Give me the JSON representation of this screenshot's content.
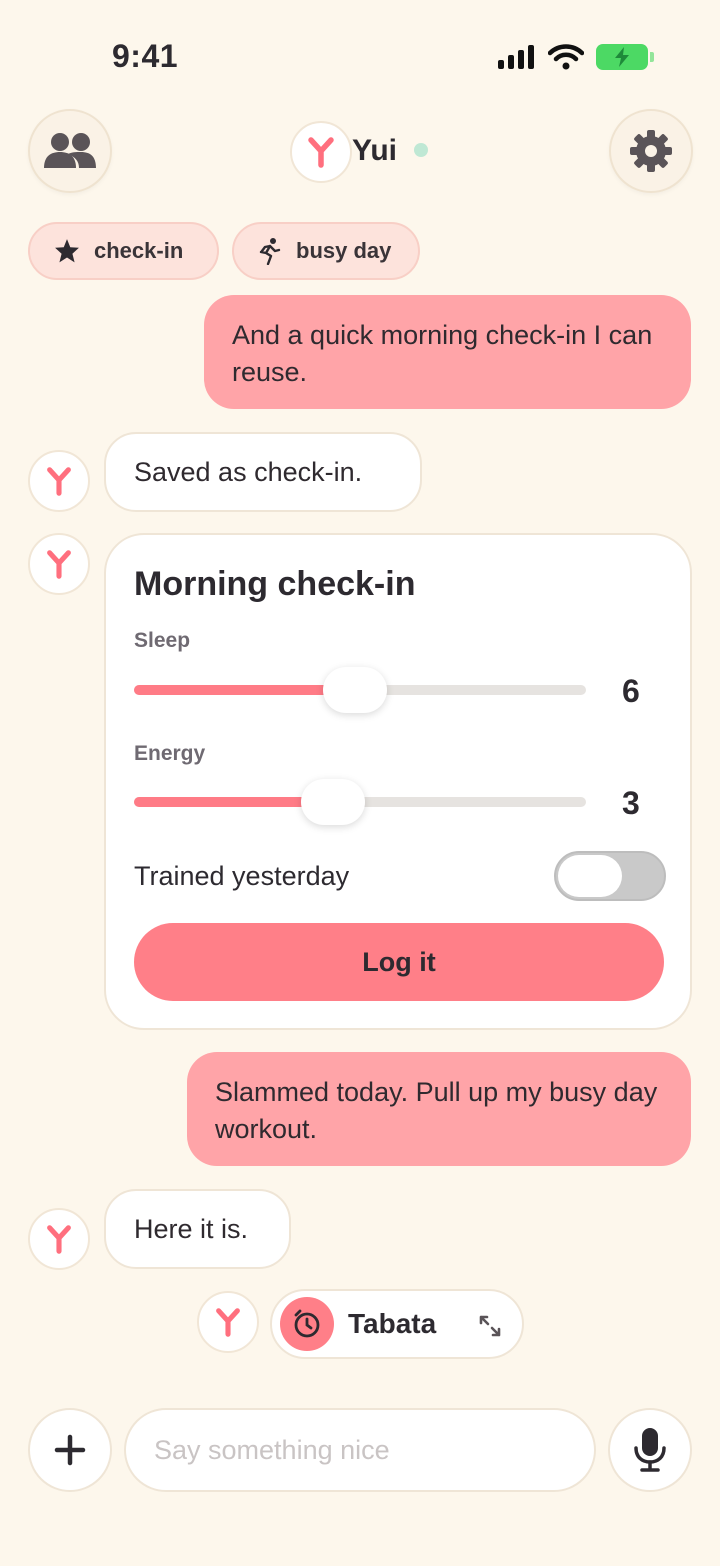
{
  "status_bar": {
    "time": "9:41"
  },
  "header": {
    "name": "Yui"
  },
  "chips": [
    {
      "label": "check-in",
      "icon": "star-icon"
    },
    {
      "label": "busy day",
      "icon": "running-icon"
    }
  ],
  "messages": {
    "user_1": "And a quick morning check-in I can reuse.",
    "bot_1": "Saved as check-in.",
    "user_2": "Slammed today. Pull up my busy day workout.",
    "bot_2": "Here it is."
  },
  "card": {
    "title": "Morning check-in",
    "sliders": [
      {
        "label": "Sleep",
        "value": "6",
        "fill": 0.49
      },
      {
        "label": "Energy",
        "value": "3",
        "fill": 0.44
      }
    ],
    "toggle": {
      "label": "Trained yesterday",
      "on": false
    },
    "button_label": "Log it"
  },
  "workout": {
    "label": "Tabata"
  },
  "composer": {
    "placeholder": "Say something nice"
  },
  "colors": {
    "background": "#fdf7ec",
    "accent": "#ff7f88",
    "user_bubble": "#ffa4a8",
    "chip": "#fde3dc",
    "online": "#bfe8d4"
  }
}
